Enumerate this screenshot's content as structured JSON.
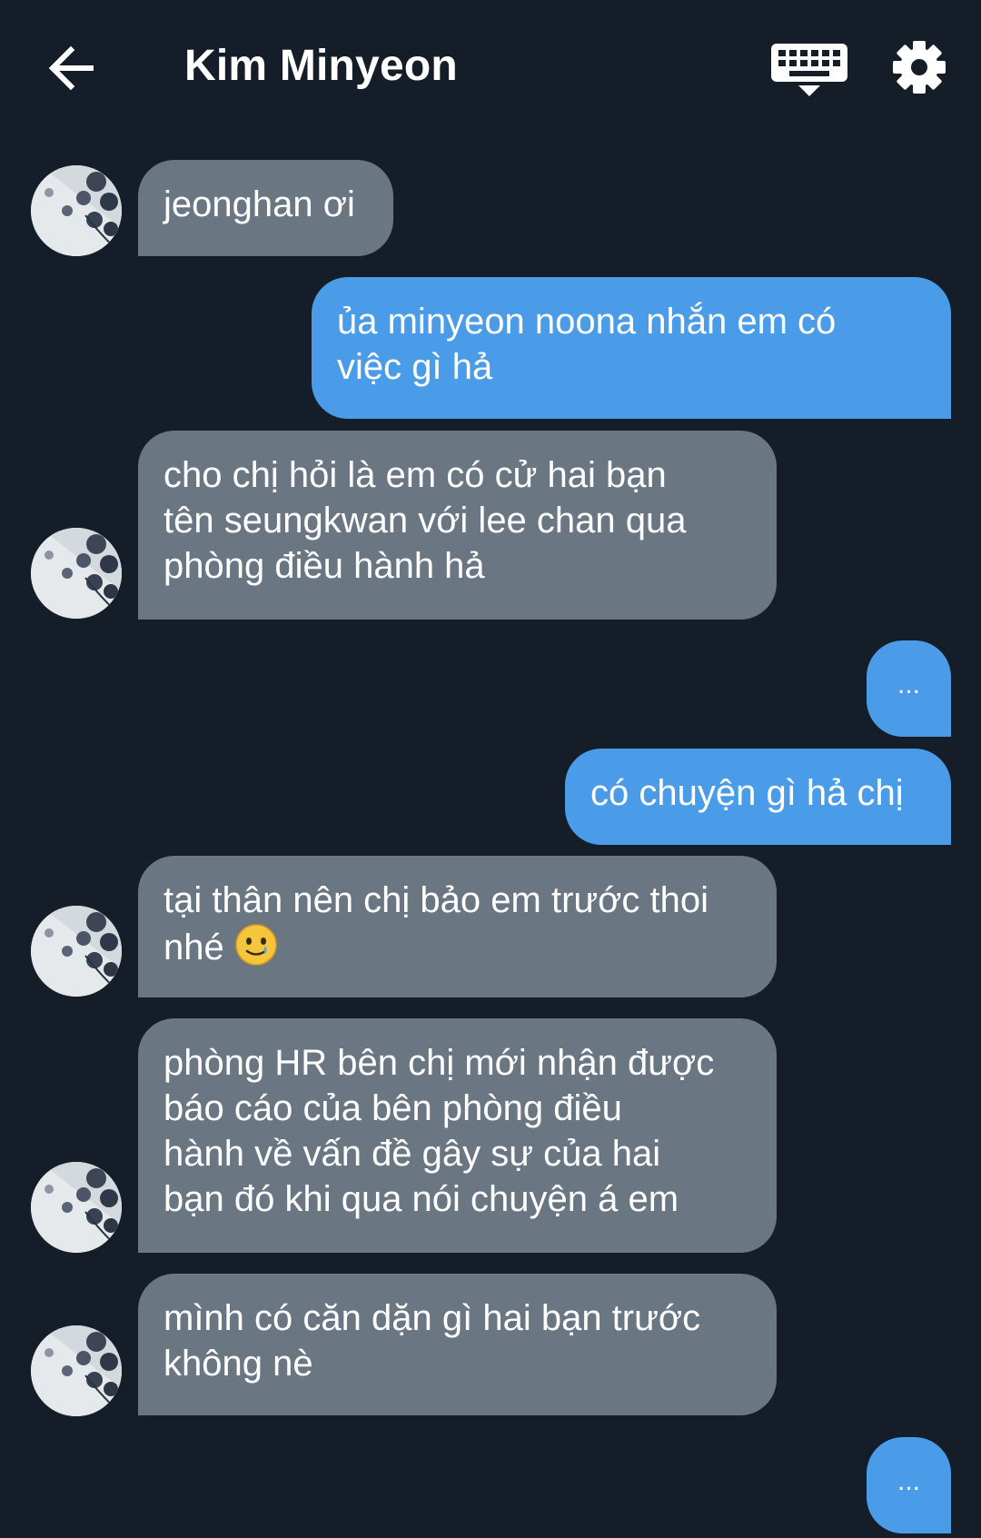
{
  "header": {
    "back_icon": "arrow-left-icon",
    "title": "Kim Minyeon",
    "keyboard_icon": "keyboard-icon",
    "settings_icon": "gear-icon"
  },
  "colors": {
    "background": "#151d28",
    "incoming_bubble": "#6a7682",
    "outgoing_bubble": "#4a9be8",
    "text": "#ffffff"
  },
  "messages": [
    {
      "sender": "incoming",
      "text": "jeonghan ơi"
    },
    {
      "sender": "outgoing",
      "text": "ủa minyeon noona nhắn em có\nviệc gì hả"
    },
    {
      "sender": "incoming",
      "text": "cho chị hỏi là em có cử hai bạn\ntên seungkwan với lee chan qua\nphòng điều hành hả"
    },
    {
      "sender": "outgoing",
      "text": "..."
    },
    {
      "sender": "outgoing",
      "text": "có chuyện gì hả chị"
    },
    {
      "sender": "incoming",
      "text": "tại thân nên chị bảo em trước thoi\nnhé",
      "emoji": "smiling-face-with-tear-emoji"
    },
    {
      "sender": "incoming",
      "text": "phòng HR bên chị mới nhận được\nbáo cáo của bên phòng điều\nhành về vấn đề gây sự của hai\nbạn đó khi qua nói chuyện á em"
    },
    {
      "sender": "incoming",
      "text": "mình có căn dặn gì hai bạn trước\nkhông nè"
    },
    {
      "sender": "outgoing",
      "text": "..."
    }
  ]
}
